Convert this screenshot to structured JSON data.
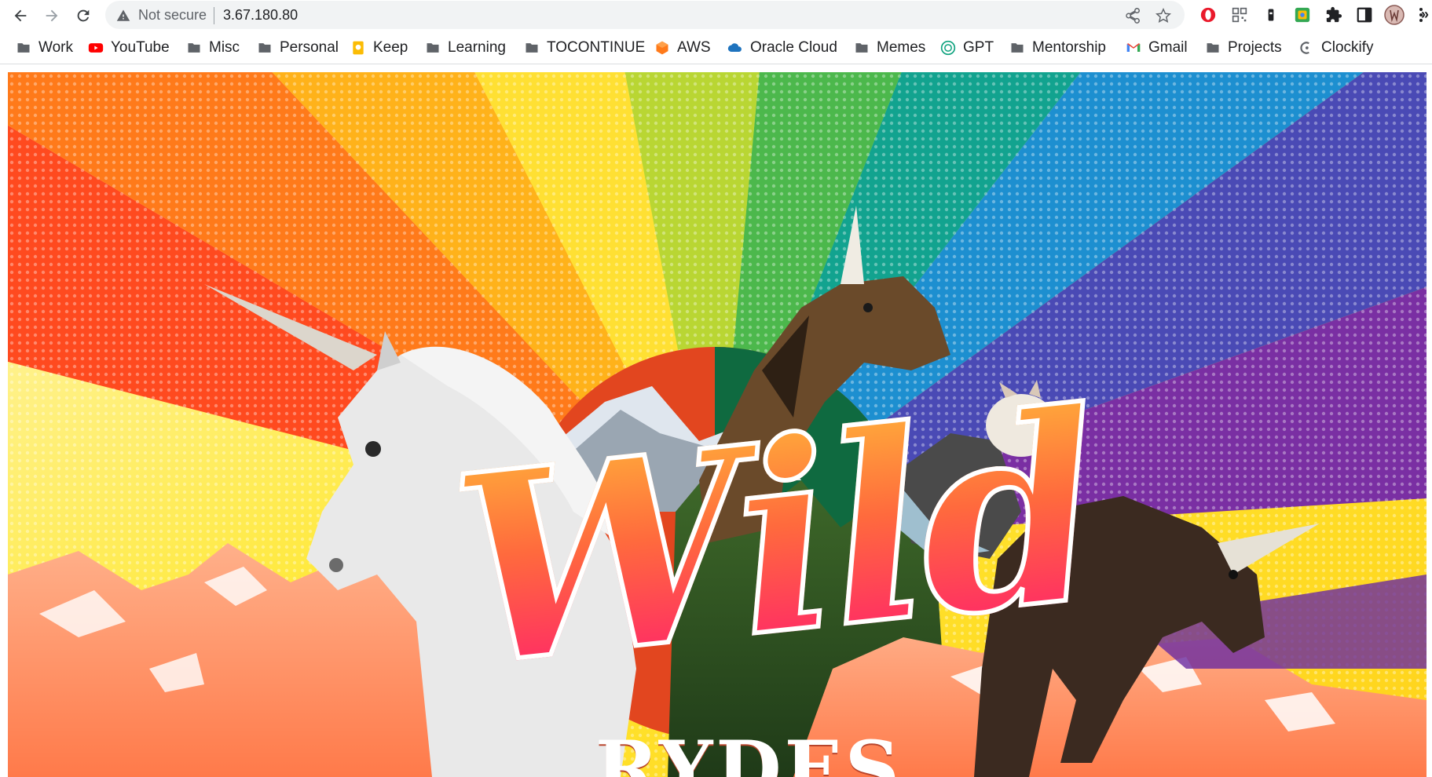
{
  "browser": {
    "security_label": "Not secure",
    "url": "3.67.180.80"
  },
  "bookmarks": [
    {
      "label": "Work",
      "icon": "folder-icon"
    },
    {
      "label": "YouTube",
      "icon": "youtube-icon"
    },
    {
      "label": "Misc",
      "icon": "folder-icon"
    },
    {
      "label": "Personal",
      "icon": "folder-icon"
    },
    {
      "label": "Keep",
      "icon": "keep-icon"
    },
    {
      "label": "Learning",
      "icon": "folder-icon"
    },
    {
      "label": "TOCONTINUE",
      "icon": "folder-icon"
    },
    {
      "label": "AWS",
      "icon": "aws-icon"
    },
    {
      "label": "Oracle Cloud",
      "icon": "cloud-icon"
    },
    {
      "label": "Memes",
      "icon": "folder-icon"
    },
    {
      "label": "GPT",
      "icon": "gpt-icon"
    },
    {
      "label": "Mentorship",
      "icon": "folder-icon"
    },
    {
      "label": "Gmail",
      "icon": "gmail-icon"
    },
    {
      "label": "Projects",
      "icon": "folder-icon"
    },
    {
      "label": "Clockify",
      "icon": "clockify-icon"
    }
  ],
  "overflow_label": "»",
  "hero": {
    "logo_main": "Wild",
    "logo_sub": "RYDES"
  },
  "colors": {
    "rainbow": [
      "#ff4a1f",
      "#ff7a1a",
      "#ffb21a",
      "#ffe033",
      "#b9d633",
      "#4cb84c",
      "#12a38f",
      "#1d8fd0",
      "#4a4ab5",
      "#7a2fa3"
    ],
    "mountain": "#ff8a5c",
    "logo_gradient_top": "#ffb33a",
    "logo_gradient_bottom": "#ff1f6d"
  }
}
